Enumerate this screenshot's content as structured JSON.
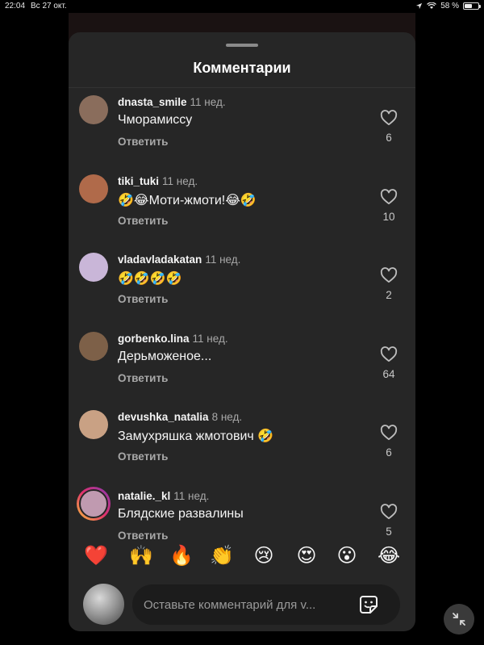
{
  "status_bar": {
    "time": "22:04",
    "date": "Вс 27 окт.",
    "battery": "58 %",
    "battery_level": 0.58
  },
  "sheet": {
    "title": "Комментарии"
  },
  "comments": [
    {
      "username": "dnasta_smile",
      "ago": "11 нед.",
      "text": "Чморамиссу",
      "reply": "Ответить",
      "likes": "6",
      "avatar_color": "#8a6d5c"
    },
    {
      "username": "tiki_tuki",
      "ago": "11 нед.",
      "text": "🤣😂Моти-жмоти!😂🤣",
      "reply": "Ответить",
      "likes": "10",
      "avatar_color": "#b06a4a"
    },
    {
      "username": "vladavladakatan",
      "ago": "11 нед.",
      "text": "🤣🤣🤣🤣",
      "reply": "Ответить",
      "likes": "2",
      "avatar_color": "#c9b6d8"
    },
    {
      "username": "gorbenko.lina",
      "ago": "11 нед.",
      "text": "Дерьможеное...",
      "reply": "Ответить",
      "likes": "64",
      "avatar_color": "#7d6048"
    },
    {
      "username": "devushka_natalia",
      "ago": "8 нед.",
      "text": "Замухряшка жмотович 🤣",
      "reply": "Ответить",
      "likes": "6",
      "avatar_color": "#c9a184"
    },
    {
      "username": "natalie._kl",
      "ago": "11 нед.",
      "text": "Блядские развалины",
      "reply": "Ответить",
      "likes": "5",
      "avatar_color": "#c09ab0"
    }
  ],
  "reactions": [
    "❤️",
    "🙌",
    "🔥",
    "👏",
    "😢",
    "😍",
    "😮",
    "😂"
  ],
  "compose": {
    "placeholder": "Оставьте комментарий для v..."
  },
  "icons": {
    "like": "heart-outline-icon",
    "sticker": "sticker-icon",
    "minimize": "collapse-arrows-icon"
  }
}
